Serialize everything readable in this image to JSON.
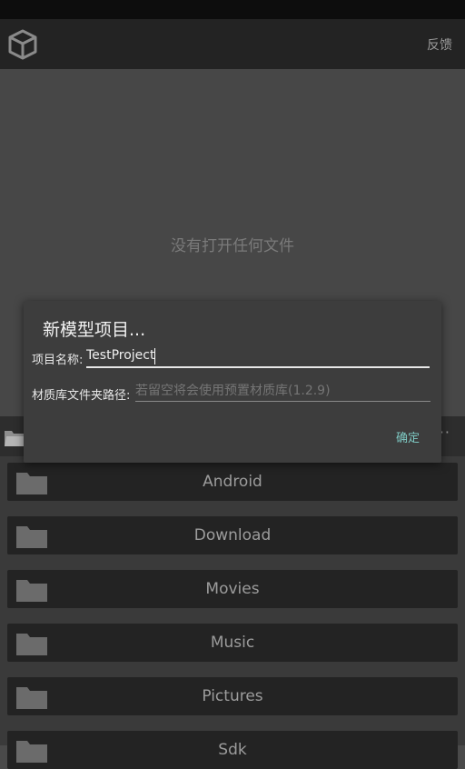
{
  "app_bar": {
    "feedback_label": "反馈",
    "icon": "cube-icon"
  },
  "viewport": {
    "empty_text": "没有打开任何文件"
  },
  "browser": {
    "more_label": "···",
    "folders": [
      {
        "name": "Android"
      },
      {
        "name": "Download"
      },
      {
        "name": "Movies"
      },
      {
        "name": "Music"
      },
      {
        "name": "Pictures"
      },
      {
        "name": "Sdk"
      }
    ]
  },
  "dialog": {
    "title": "新模型项目...",
    "project_name_label": "项目名称:",
    "project_name_value": "TestProject",
    "material_path_label": "材质库文件夹路径:",
    "material_path_placeholder": "若留空将会使用预置材质库(1.2.9)",
    "confirm_label": "确定"
  },
  "colors": {
    "accent": "#7ec9c3",
    "background": "#4a4a4a",
    "app_bar": "#232323"
  }
}
